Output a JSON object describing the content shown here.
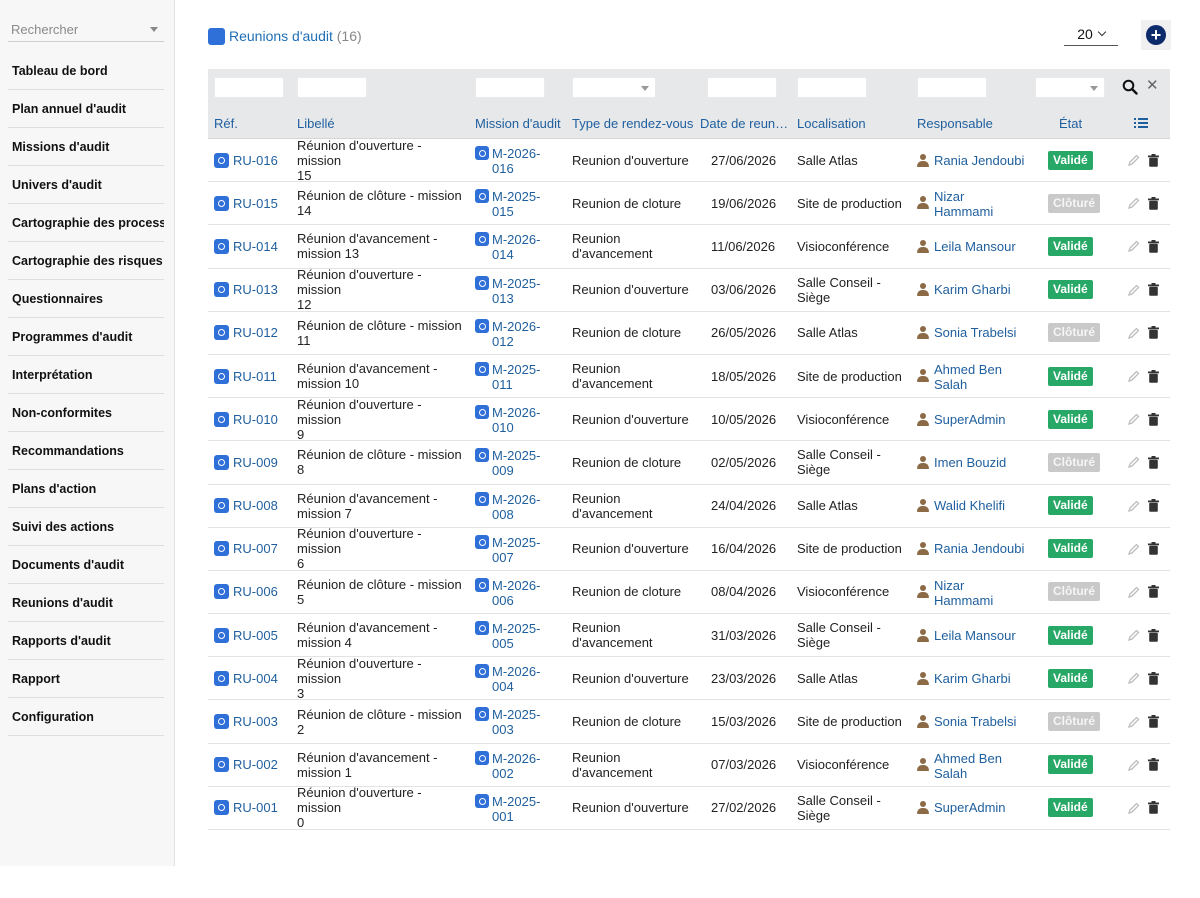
{
  "sidebar": {
    "search_placeholder": "Rechercher",
    "items": [
      "Tableau de bord",
      "Plan annuel d'audit",
      "Missions d'audit",
      "Univers d'audit",
      "Cartographie des processus",
      "Cartographie des risques",
      "Questionnaires",
      "Programmes d'audit",
      "Interprétation",
      "Non-conformites",
      "Recommandations",
      "Plans d'action",
      "Suivi des actions",
      "Documents d'audit",
      "Reunions d'audit",
      "Rapports d'audit",
      "Rapport",
      "Configuration"
    ]
  },
  "header": {
    "title": "Reunions d'audit",
    "count": "(16)",
    "page_size": "20"
  },
  "columns": {
    "ref": "Réf.",
    "libelle": "Libellé",
    "mission": "Mission d'audit",
    "type": "Type de rendez-vous",
    "date": "Date de reun…",
    "localisation": "Localisation",
    "responsable": "Responsable",
    "etat": "État"
  },
  "rows": [
    {
      "ref": "RU-016",
      "libelle": [
        "Réunion d'ouverture - mission",
        "15"
      ],
      "mission": [
        "M-2026-",
        "016"
      ],
      "type": [
        "Reunion d'ouverture"
      ],
      "date": "27/06/2026",
      "loc": [
        "Salle Atlas"
      ],
      "resp": [
        "Rania Jendoubi"
      ],
      "etat": "Validé"
    },
    {
      "ref": "RU-015",
      "libelle": [
        "Réunion de clôture - mission",
        "14"
      ],
      "mission": [
        "M-2025-",
        "015"
      ],
      "type": [
        "Reunion de cloture"
      ],
      "date": "19/06/2026",
      "loc": [
        "Site de production"
      ],
      "resp": [
        "Nizar",
        "Hammami"
      ],
      "etat": "Clôturé"
    },
    {
      "ref": "RU-014",
      "libelle": [
        "Réunion d'avancement -",
        "mission 13"
      ],
      "mission": [
        "M-2026-",
        "014"
      ],
      "type": [
        "Reunion",
        "d'avancement"
      ],
      "date": "11/06/2026",
      "loc": [
        "Visioconférence"
      ],
      "resp": [
        "Leila Mansour"
      ],
      "etat": "Validé"
    },
    {
      "ref": "RU-013",
      "libelle": [
        "Réunion d'ouverture - mission",
        "12"
      ],
      "mission": [
        "M-2025-",
        "013"
      ],
      "type": [
        "Reunion d'ouverture"
      ],
      "date": "03/06/2026",
      "loc": [
        "Salle Conseil -",
        "Siège"
      ],
      "resp": [
        "Karim Gharbi"
      ],
      "etat": "Validé"
    },
    {
      "ref": "RU-012",
      "libelle": [
        "Réunion de clôture - mission",
        "11"
      ],
      "mission": [
        "M-2026-",
        "012"
      ],
      "type": [
        "Reunion de cloture"
      ],
      "date": "26/05/2026",
      "loc": [
        "Salle Atlas"
      ],
      "resp": [
        "Sonia Trabelsi"
      ],
      "etat": "Clôturé"
    },
    {
      "ref": "RU-011",
      "libelle": [
        "Réunion d'avancement -",
        "mission 10"
      ],
      "mission": [
        "M-2025-",
        "011"
      ],
      "type": [
        "Reunion",
        "d'avancement"
      ],
      "date": "18/05/2026",
      "loc": [
        "Site de production"
      ],
      "resp": [
        "Ahmed Ben",
        "Salah"
      ],
      "etat": "Validé"
    },
    {
      "ref": "RU-010",
      "libelle": [
        "Réunion d'ouverture - mission",
        "9"
      ],
      "mission": [
        "M-2026-",
        "010"
      ],
      "type": [
        "Reunion d'ouverture"
      ],
      "date": "10/05/2026",
      "loc": [
        "Visioconférence"
      ],
      "resp": [
        "SuperAdmin"
      ],
      "etat": "Validé"
    },
    {
      "ref": "RU-009",
      "libelle": [
        "Réunion de clôture - mission",
        "8"
      ],
      "mission": [
        "M-2025-",
        "009"
      ],
      "type": [
        "Reunion de cloture"
      ],
      "date": "02/05/2026",
      "loc": [
        "Salle Conseil -",
        "Siège"
      ],
      "resp": [
        "Imen Bouzid"
      ],
      "etat": "Clôturé"
    },
    {
      "ref": "RU-008",
      "libelle": [
        "Réunion d'avancement -",
        "mission 7"
      ],
      "mission": [
        "M-2026-",
        "008"
      ],
      "type": [
        "Reunion",
        "d'avancement"
      ],
      "date": "24/04/2026",
      "loc": [
        "Salle Atlas"
      ],
      "resp": [
        "Walid Khelifi"
      ],
      "etat": "Validé"
    },
    {
      "ref": "RU-007",
      "libelle": [
        "Réunion d'ouverture - mission",
        "6"
      ],
      "mission": [
        "M-2025-",
        "007"
      ],
      "type": [
        "Reunion d'ouverture"
      ],
      "date": "16/04/2026",
      "loc": [
        "Site de production"
      ],
      "resp": [
        "Rania Jendoubi"
      ],
      "etat": "Validé"
    },
    {
      "ref": "RU-006",
      "libelle": [
        "Réunion de clôture - mission",
        "5"
      ],
      "mission": [
        "M-2026-",
        "006"
      ],
      "type": [
        "Reunion de cloture"
      ],
      "date": "08/04/2026",
      "loc": [
        "Visioconférence"
      ],
      "resp": [
        "Nizar",
        "Hammami"
      ],
      "etat": "Clôturé"
    },
    {
      "ref": "RU-005",
      "libelle": [
        "Réunion d'avancement -",
        "mission 4"
      ],
      "mission": [
        "M-2025-",
        "005"
      ],
      "type": [
        "Reunion",
        "d'avancement"
      ],
      "date": "31/03/2026",
      "loc": [
        "Salle Conseil -",
        "Siège"
      ],
      "resp": [
        "Leila Mansour"
      ],
      "etat": "Validé"
    },
    {
      "ref": "RU-004",
      "libelle": [
        "Réunion d'ouverture - mission",
        "3"
      ],
      "mission": [
        "M-2026-",
        "004"
      ],
      "type": [
        "Reunion d'ouverture"
      ],
      "date": "23/03/2026",
      "loc": [
        "Salle Atlas"
      ],
      "resp": [
        "Karim Gharbi"
      ],
      "etat": "Validé"
    },
    {
      "ref": "RU-003",
      "libelle": [
        "Réunion de clôture - mission",
        "2"
      ],
      "mission": [
        "M-2025-",
        "003"
      ],
      "type": [
        "Reunion de cloture"
      ],
      "date": "15/03/2026",
      "loc": [
        "Site de production"
      ],
      "resp": [
        "Sonia Trabelsi"
      ],
      "etat": "Clôturé"
    },
    {
      "ref": "RU-002",
      "libelle": [
        "Réunion d'avancement -",
        "mission 1"
      ],
      "mission": [
        "M-2026-",
        "002"
      ],
      "type": [
        "Reunion",
        "d'avancement"
      ],
      "date": "07/03/2026",
      "loc": [
        "Visioconférence"
      ],
      "resp": [
        "Ahmed Ben",
        "Salah"
      ],
      "etat": "Validé"
    },
    {
      "ref": "RU-001",
      "libelle": [
        "Réunion d'ouverture - mission",
        "0"
      ],
      "mission": [
        "M-2025-",
        "001"
      ],
      "type": [
        "Reunion d'ouverture"
      ],
      "date": "27/02/2026",
      "loc": [
        "Salle Conseil -",
        "Siège"
      ],
      "resp": [
        "SuperAdmin"
      ],
      "etat": "Validé"
    }
  ],
  "colors": {
    "accent": "#1f5f9e",
    "valid": "#27a866",
    "closed": "#c9c9c9",
    "add_button": "#0d2a6b"
  },
  "icons": [
    "reunion-icon",
    "mission-icon",
    "person-icon",
    "pencil-icon",
    "trash-icon",
    "search-icon",
    "close-icon",
    "list-icon",
    "plus-icon",
    "chevron-down-icon"
  ]
}
